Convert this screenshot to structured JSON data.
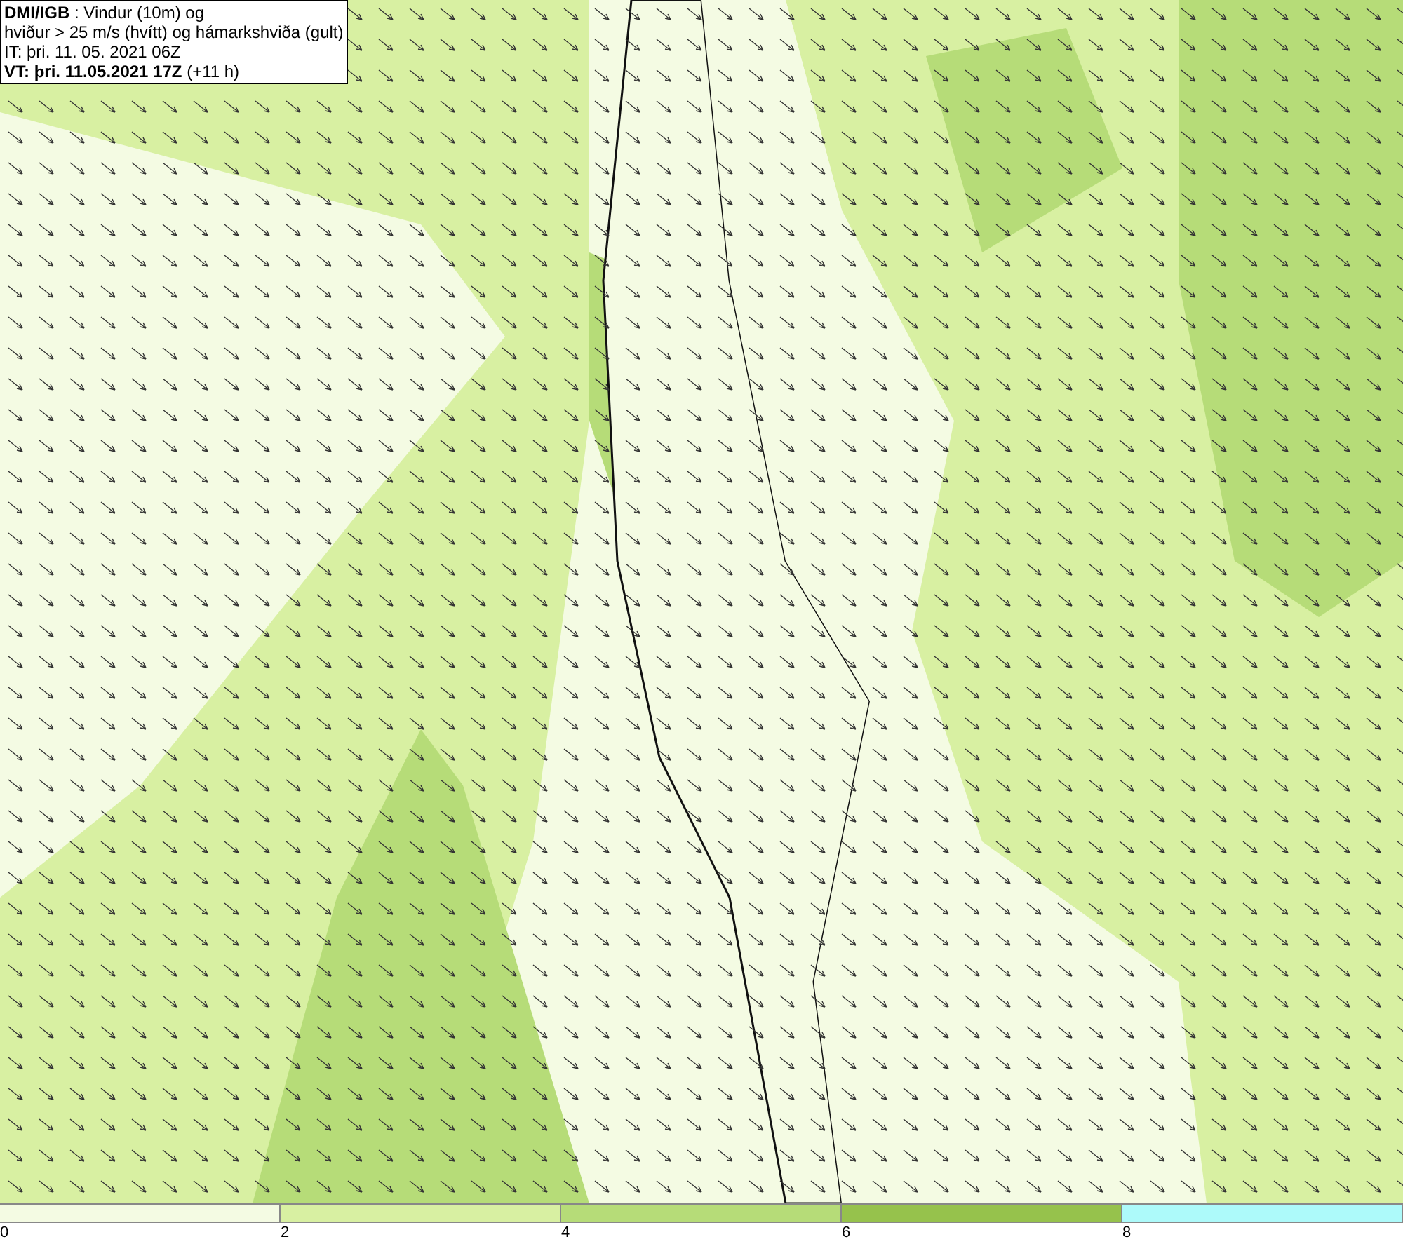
{
  "header": {
    "lines": [
      "**DMI/IGB** : Vindur (10m) og",
      "hviður > 25 m/s (hvítt) og hámarkshviða (gult)",
      "IT: þri. 11. 05. 2021 06Z",
      "**VT: þri. 11.05.2021 17Z** (+11 h)"
    ]
  },
  "legend": {
    "segments": [
      {
        "color": "#f4fbe3"
      },
      {
        "color": "#d8f0a2"
      },
      {
        "color": "#b6dc78"
      },
      {
        "color": "#96c24c"
      },
      {
        "color": "#adfafa"
      }
    ],
    "ticks": [
      "0",
      "2",
      "4",
      "6",
      "8"
    ]
  }
}
